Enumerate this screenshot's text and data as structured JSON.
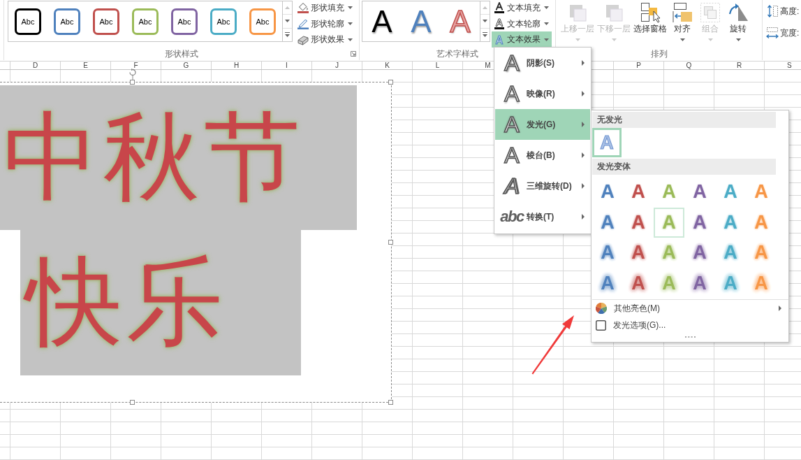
{
  "ribbon": {
    "shape_styles": {
      "label": "形状样式",
      "scroll_up_disabled": true,
      "swatches": [
        {
          "text": "Abc",
          "color": "#000000"
        },
        {
          "text": "Abc",
          "color": "#4f81bd"
        },
        {
          "text": "Abc",
          "color": "#c0504d"
        },
        {
          "text": "Abc",
          "color": "#9bbb59"
        },
        {
          "text": "Abc",
          "color": "#8064a2"
        },
        {
          "text": "Abc",
          "color": "#4bacc6"
        },
        {
          "text": "Abc",
          "color": "#f79646"
        }
      ],
      "commands": [
        {
          "label": "形状填充",
          "kind": "fill"
        },
        {
          "label": "形状轮廓",
          "kind": "outline"
        },
        {
          "label": "形状效果",
          "kind": "effects"
        }
      ]
    },
    "wordart_styles": {
      "label": "艺术字样式",
      "scroll_up_disabled": true,
      "swatches": [
        {
          "text": "A",
          "color": "#000000",
          "kind": "fill"
        },
        {
          "text": "A",
          "color": "#4f81bd",
          "kind": "fill"
        },
        {
          "text": "A",
          "color": "#e6a1a0",
          "kind": "outline"
        }
      ],
      "commands": [
        {
          "label": "文本填充",
          "kind": "fill",
          "highlighted": false
        },
        {
          "label": "文本轮廓",
          "kind": "outline",
          "highlighted": false
        },
        {
          "label": "文本效果",
          "kind": "effects",
          "highlighted": true
        }
      ]
    },
    "arrange": {
      "label": "排列",
      "commands": [
        {
          "label": "上移一层",
          "kind": "bring_forward",
          "disabled": true,
          "dropdown": true
        },
        {
          "label": "下移一层",
          "kind": "send_backward",
          "disabled": true,
          "dropdown": true
        },
        {
          "label": "选择窗格",
          "kind": "selection_pane",
          "disabled": false,
          "dropdown": false
        },
        {
          "label": "对齐",
          "kind": "align",
          "disabled": false,
          "dropdown": true
        },
        {
          "label": "组合",
          "kind": "group",
          "disabled": true,
          "dropdown": true
        },
        {
          "label": "旋转",
          "kind": "rotate",
          "disabled": false,
          "dropdown": true
        }
      ]
    },
    "size": {
      "fields": [
        {
          "label": "高度:",
          "kind": "height"
        },
        {
          "label": "宽度:",
          "kind": "width"
        }
      ]
    }
  },
  "column_headers_left": [
    "D",
    "E",
    "F",
    "G",
    "H",
    "I",
    "J",
    "K",
    "L",
    "M"
  ],
  "column_headers_right": [
    "P",
    "Q",
    "R",
    "S"
  ],
  "text_box": {
    "lines": [
      "中秋节",
      "快乐"
    ]
  },
  "text_effects_menu": {
    "items": [
      {
        "preview": "A",
        "label": "阴影(S)",
        "kind": "shadow",
        "highlighted": false
      },
      {
        "preview": "A",
        "label": "映像(R)",
        "kind": "reflection",
        "highlighted": false
      },
      {
        "preview": "A",
        "label": "发光(G)",
        "kind": "glow",
        "highlighted": true
      },
      {
        "preview": "A",
        "label": "棱台(B)",
        "kind": "bevel",
        "highlighted": false
      },
      {
        "preview": "A",
        "label": "三维旋转(D)",
        "kind": "rotation",
        "highlighted": false
      },
      {
        "preview": "abc",
        "label": "转换(T)",
        "kind": "transform",
        "highlighted": false
      }
    ]
  },
  "glow_submenu": {
    "no_glow_heading": "无发光",
    "no_glow": {
      "preview": "A",
      "selected": true
    },
    "variations_heading": "发光变体",
    "variations": [
      {
        "items": [
          {
            "preview": "A",
            "color": "#4f81bd",
            "highlighted": false
          },
          {
            "preview": "A",
            "color": "#c0504d",
            "highlighted": false
          },
          {
            "preview": "A",
            "color": "#9bbb59",
            "highlighted": false
          },
          {
            "preview": "A",
            "color": "#8064a2",
            "highlighted": false
          },
          {
            "preview": "A",
            "color": "#4bacc6",
            "highlighted": false
          },
          {
            "preview": "A",
            "color": "#f79646",
            "highlighted": false
          }
        ]
      },
      {
        "items": [
          {
            "preview": "A",
            "color": "#4f81bd",
            "highlighted": false
          },
          {
            "preview": "A",
            "color": "#c0504d",
            "highlighted": false
          },
          {
            "preview": "A",
            "color": "#9bbb59",
            "highlighted": true
          },
          {
            "preview": "A",
            "color": "#8064a2",
            "highlighted": false
          },
          {
            "preview": "A",
            "color": "#4bacc6",
            "highlighted": false
          },
          {
            "preview": "A",
            "color": "#f79646",
            "highlighted": false
          }
        ]
      },
      {
        "items": [
          {
            "preview": "A",
            "color": "#4f81bd",
            "highlighted": false
          },
          {
            "preview": "A",
            "color": "#c0504d",
            "highlighted": false
          },
          {
            "preview": "A",
            "color": "#9bbb59",
            "highlighted": false
          },
          {
            "preview": "A",
            "color": "#8064a2",
            "highlighted": false
          },
          {
            "preview": "A",
            "color": "#4bacc6",
            "highlighted": false
          },
          {
            "preview": "A",
            "color": "#f79646",
            "highlighted": false
          }
        ]
      },
      {
        "items": [
          {
            "preview": "A",
            "color": "#4f81bd",
            "highlighted": false
          },
          {
            "preview": "A",
            "color": "#c0504d",
            "highlighted": false
          },
          {
            "preview": "A",
            "color": "#9bbb59",
            "highlighted": false
          },
          {
            "preview": "A",
            "color": "#8064a2",
            "highlighted": false
          },
          {
            "preview": "A",
            "color": "#4bacc6",
            "highlighted": false
          },
          {
            "preview": "A",
            "color": "#f79646",
            "highlighted": false
          }
        ]
      }
    ],
    "more_colors": {
      "label": "其他亮色(M)"
    },
    "options": {
      "label": "发光选项(G)..."
    }
  }
}
